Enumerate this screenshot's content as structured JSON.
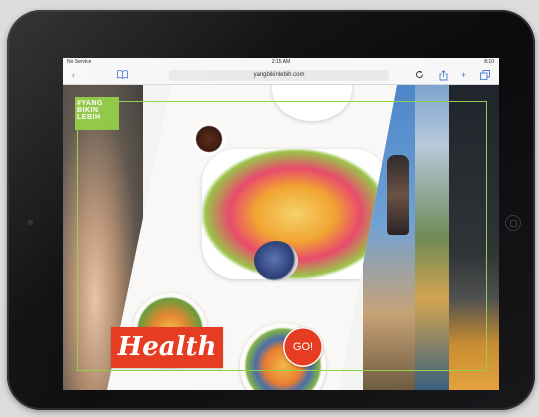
{
  "status_bar": {
    "carrier": "No Service",
    "time": "2:15 AM",
    "battery": "8:10"
  },
  "browser": {
    "url": "yangbikinlebih.com",
    "icons": {
      "back": "chevron-left-icon",
      "bookmarks": "book-icon",
      "reload": "reload-icon",
      "share": "share-icon",
      "new_tab": "plus-icon",
      "tabs": "tabs-icon"
    }
  },
  "hero": {
    "logo_lines": [
      "#YANG",
      "BIKIN",
      "LEBIH"
    ],
    "category_label": "Health",
    "go_label": "GO!"
  },
  "colors": {
    "accent_red": "#e53c22",
    "logo_green": "#8dc63f",
    "frame_line": "#8fd14a",
    "link_blue": "#4a7bd0"
  }
}
